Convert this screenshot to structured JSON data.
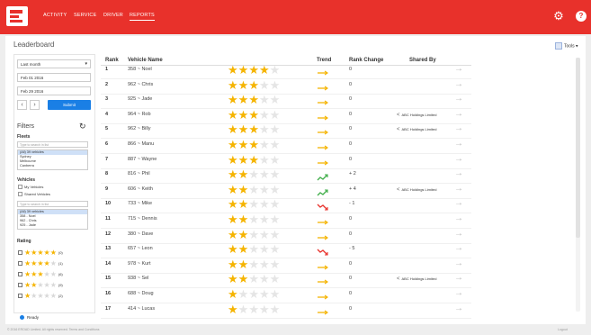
{
  "topbar": {
    "nav": [
      "ACTIVITY",
      "SERVICE",
      "DRIVER",
      "REPORTS"
    ],
    "active_index": 3,
    "help_label": "?"
  },
  "page": {
    "title": "Leaderboard",
    "tools_label": "Tools ▾"
  },
  "sidebar": {
    "period_value": "Last month",
    "date_from": "Feb 01 2016",
    "date_to": "Feb 29 2016",
    "prev_label": "‹",
    "next_label": "›",
    "submit_label": "Submit",
    "filters_title": "Filters",
    "fleets_title": "Fleets",
    "fleets_search_placeholder": "Type to search in list",
    "fleets": [
      "(All) 39 vehicles",
      "Sydney",
      "Melbourne",
      "Canberra"
    ],
    "vehicles_title": "Vehicles",
    "vehicle_checks": [
      "My Vehicles",
      "Shared Vehicles"
    ],
    "vehicles_search_placeholder": "Type to search in list",
    "vehicles": [
      "(All) 39 vehicles",
      "358 - Noel",
      "962 - Chris",
      "925 - Jade"
    ],
    "rating_title": "Rating",
    "ratings": [
      {
        "stars": 5,
        "count": "(0)"
      },
      {
        "stars": 4,
        "count": "(1)"
      },
      {
        "stars": 3,
        "count": "(6)"
      },
      {
        "stars": 2,
        "count": "(9)"
      },
      {
        "stars": 1,
        "count": "(2)"
      }
    ]
  },
  "table": {
    "headers": [
      "Rank",
      "Vehicle Name",
      "Trend",
      "Rank Change",
      "Shared By"
    ],
    "rows": [
      {
        "rank": "1",
        "vehicle": "358 ~ Noel",
        "stars": 4,
        "trend": "flat",
        "change": "0",
        "shared": ""
      },
      {
        "rank": "2",
        "vehicle": "962 ~ Chris",
        "stars": 3,
        "trend": "flat",
        "change": "0",
        "shared": ""
      },
      {
        "rank": "3",
        "vehicle": "925 ~ Jade",
        "stars": 3,
        "trend": "flat",
        "change": "0",
        "shared": ""
      },
      {
        "rank": "4",
        "vehicle": "964 ~ Rob",
        "stars": 3,
        "trend": "flat",
        "change": "0",
        "shared": "ABC Holdings Limited"
      },
      {
        "rank": "5",
        "vehicle": "962 ~ Billy",
        "stars": 3,
        "trend": "flat",
        "change": "0",
        "shared": "ABC Holdings Limited"
      },
      {
        "rank": "6",
        "vehicle": "866 ~ Manu",
        "stars": 3,
        "trend": "flat",
        "change": "0",
        "shared": ""
      },
      {
        "rank": "7",
        "vehicle": "887 ~ Wayne",
        "stars": 3,
        "trend": "flat",
        "change": "0",
        "shared": ""
      },
      {
        "rank": "8",
        "vehicle": "816 ~ Phil",
        "stars": 2,
        "trend": "up",
        "change": "+ 2",
        "shared": ""
      },
      {
        "rank": "9",
        "vehicle": "606 ~ Keith",
        "stars": 2,
        "trend": "up",
        "change": "+ 4",
        "shared": "ABC Holdings Limited"
      },
      {
        "rank": "10",
        "vehicle": "733 ~ Mike",
        "stars": 2,
        "trend": "down",
        "change": "- 1",
        "shared": ""
      },
      {
        "rank": "11",
        "vehicle": "715 ~ Dennis",
        "stars": 2,
        "trend": "flat",
        "change": "0",
        "shared": ""
      },
      {
        "rank": "12",
        "vehicle": "380 ~ Dave",
        "stars": 2,
        "trend": "flat",
        "change": "0",
        "shared": ""
      },
      {
        "rank": "13",
        "vehicle": "657 ~ Leon",
        "stars": 2,
        "trend": "down",
        "change": "- 5",
        "shared": ""
      },
      {
        "rank": "14",
        "vehicle": "978 ~ Kurt",
        "stars": 2,
        "trend": "flat",
        "change": "0",
        "shared": ""
      },
      {
        "rank": "15",
        "vehicle": "938 ~ Sel",
        "stars": 2,
        "trend": "flat",
        "change": "0",
        "shared": "ABC Holdings Limited"
      },
      {
        "rank": "16",
        "vehicle": "688 ~ Doug",
        "stars": 1,
        "trend": "flat",
        "change": "0",
        "shared": ""
      },
      {
        "rank": "17",
        "vehicle": "414 ~ Lucas",
        "stars": 1,
        "trend": "flat",
        "change": "0",
        "shared": ""
      }
    ]
  },
  "status_label": "Ready",
  "footer": {
    "copyright": "© 2016 EROAD Limited. All rights reserved.   Terms and Conditions",
    "right": "Logout"
  },
  "colors": {
    "brand": "#e8312b",
    "star": "#f5b400",
    "trend_flat": "#f5b400",
    "trend_up": "#3fae49",
    "trend_down": "#e8312b",
    "accent": "#1a7fe5"
  },
  "icons": {
    "settings": "gear-icon",
    "help": "help-icon",
    "reset": "refresh-icon",
    "share": "share-icon",
    "row_go": "arrow-right-icon"
  }
}
